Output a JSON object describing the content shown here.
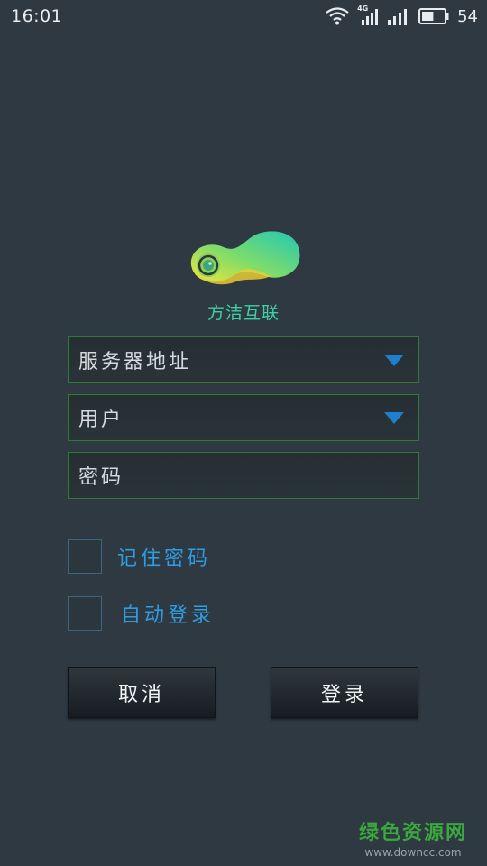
{
  "status_bar": {
    "time": "16:01",
    "network_label": "4G",
    "battery_level_percent": 54,
    "battery_text": "54",
    "icons": [
      "wifi-icon",
      "signal-4g-icon",
      "signal-icon",
      "battery-icon"
    ]
  },
  "brand": {
    "name": "方洁互联",
    "color": "#3fd0a8"
  },
  "form": {
    "server_address_placeholder": "服务器地址",
    "user_placeholder": "用户",
    "password_placeholder": "密码",
    "field_border_color": "#2f7a3a",
    "arrow_color": "#1f7fcf"
  },
  "options": {
    "remember_password": {
      "label": "记住密码",
      "checked": false
    },
    "auto_login": {
      "label": "自动登录",
      "checked": false
    },
    "label_color": "#2f9de4"
  },
  "actions": {
    "cancel_label": "取消",
    "login_label": "登录"
  },
  "watermark": {
    "title": "绿色资源网",
    "url": "www.downcc.com"
  }
}
